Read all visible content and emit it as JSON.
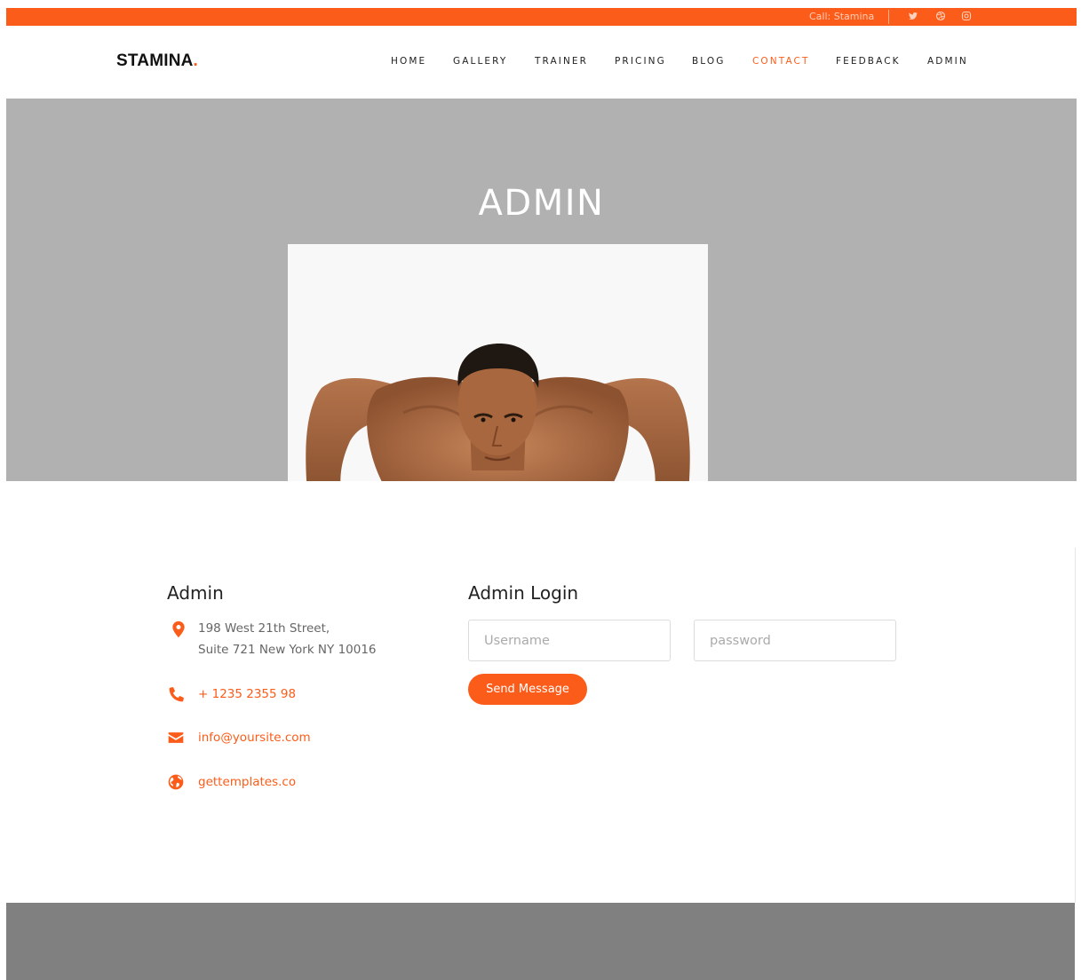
{
  "topbar": {
    "call_text": "Call: Stamina",
    "social_icons": [
      "twitter-icon",
      "dribbble-icon",
      "instagram-icon"
    ]
  },
  "header": {
    "logo_text": "STAMINA",
    "logo_dot": ".",
    "nav": [
      {
        "label": "HOME"
      },
      {
        "label": "GALLERY"
      },
      {
        "label": "TRAINER"
      },
      {
        "label": "PRICING"
      },
      {
        "label": "BLOG"
      },
      {
        "label": "CONTACT",
        "active": true
      },
      {
        "label": "FEEDBACK"
      },
      {
        "label": "ADMIN"
      }
    ]
  },
  "hero": {
    "title": "ADMIN"
  },
  "contact": {
    "info_title": "Admin",
    "address_line1": "198 West 21th Street,",
    "address_line2": "Suite 721 New York NY 10016",
    "phone": "+ 1235 2355 98",
    "email": "info@yoursite.com",
    "website": "gettemplates.co",
    "login_title": "Admin Login",
    "username_placeholder": "Username",
    "password_placeholder": "password",
    "submit_label": "Send Message"
  },
  "colors": {
    "accent": "#fc5c19",
    "hero_bg": "#b1b1b1",
    "footer_bg": "#808080"
  }
}
